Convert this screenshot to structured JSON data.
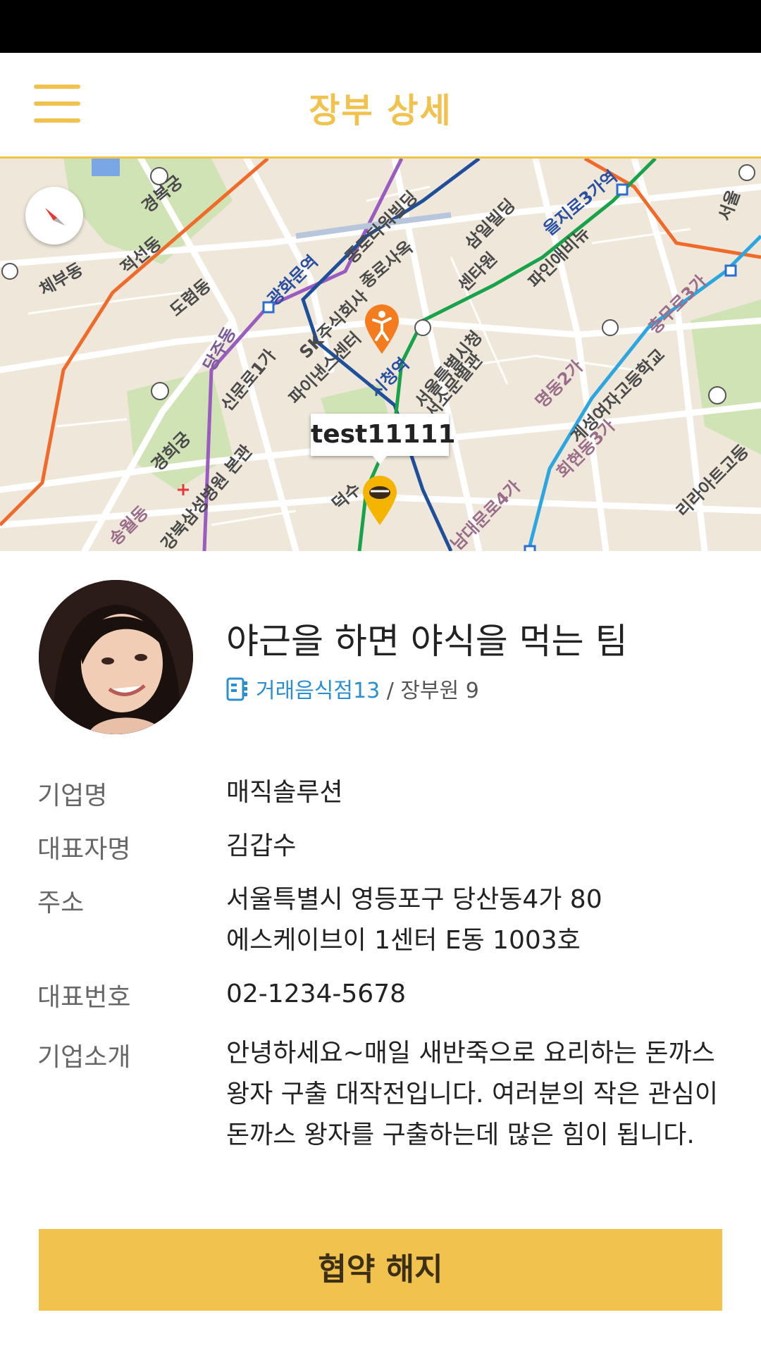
{
  "header": {
    "title": "장부 상세",
    "menu_icon": "hamburger-menu-icon"
  },
  "map": {
    "marker_label": "test11111",
    "colors": {
      "land": "#efe7da",
      "park": "#cfe3b5",
      "line_orange": "#f06a2a",
      "line_purple": "#9a5cc0",
      "line_blue": "#1f4f9b",
      "line_green": "#18a34a",
      "line_lightblue": "#2aa6e0"
    },
    "place_labels": [
      "경복궁",
      "체부동",
      "적선동",
      "도렴동",
      "광화문역",
      "종로타워빌딩",
      "종로사옥",
      "삼일빌딩",
      "을지로3가역",
      "서울",
      "SK주식회사",
      "센타원",
      "파인애비뉴",
      "당주동",
      "신문로1가",
      "파이낸스센터",
      "시청역",
      "서울특별시청",
      "서소문별관",
      "명동2가",
      "충무로3가",
      "계성여자고등학교",
      "경희궁",
      "회현동3가",
      "강북삼성병원 본관",
      "송월동",
      "덕수",
      "남대문로4가",
      "리라아트고등"
    ]
  },
  "profile": {
    "team_name": "야근을 하면 야식을 먹는 팀",
    "restaurant_link": "거래음식점13",
    "separator": "/",
    "member_label": "장부원",
    "member_count": "9",
    "book_icon": "ledger-book-icon"
  },
  "info": {
    "company_label": "기업명",
    "company_value": "매직솔루션",
    "ceo_label": "대표자명",
    "ceo_value": "김갑수",
    "address_label": "주소",
    "address_line1": "서울특별시 영등포구 당산동4가 80",
    "address_line2": "에스케이브이 1센터 E동 1003호",
    "phone_label": "대표번호",
    "phone_value": "02-1234-5678",
    "intro_label": "기업소개",
    "intro_value": "안녕하세요~매일 새반죽으로 요리하는 돈까스왕자 구출 대작전입니다. 여러분의 작은 관심이 돈까스 왕자를 구출하는데 많은 힘이 됩니다."
  },
  "actions": {
    "terminate_label": "협약 해지"
  },
  "theme": {
    "accent": "#f1c24d",
    "link": "#2a8fd0"
  }
}
